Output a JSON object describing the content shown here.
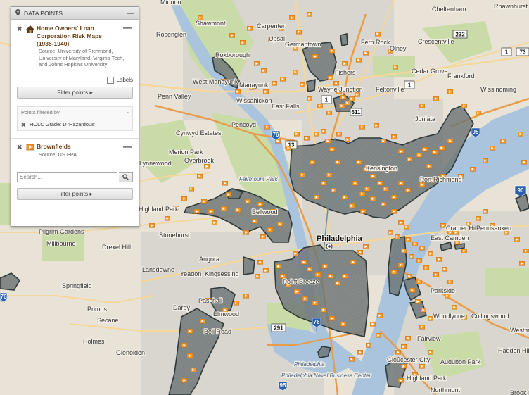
{
  "panel": {
    "title": "DATA POINTS",
    "collapse_symbol": "—",
    "layers": [
      {
        "title": "Home Owners' Loan Corporation Risk Maps (1935-1940)",
        "source": "Source: University of Richmond, University of Maryland, Virginia Tech, and Johns Hopkins University",
        "icon": "holc-house-icon"
      },
      {
        "title": "Brownfields",
        "source": "Source: US EPA",
        "icon": "brownfield-flag-icon"
      }
    ],
    "labels_checkbox": "Labels",
    "labels_checked": false,
    "filter_button": "Filter points ▸",
    "filtered_by_label": "Points filtered by:",
    "filtered_by_dash": "-",
    "filter_value": "HOLC Grade: D 'Hazardous'",
    "search_placeholder": "Search...",
    "filter_button_2": "Filter points ▸"
  },
  "map": {
    "places": [
      "Miquon",
      "Shawmont",
      "Carpenter",
      "Upsal",
      "Germantown",
      "Cheltenham",
      "Rhawnhurst",
      "Rosenglen",
      "Roxborough",
      "Fern Rock",
      "Olney",
      "Crescentville",
      "Cedar Grove",
      "Frankford",
      "West Manayunk",
      "Manayunk",
      "Penn Valley",
      "Wissahickon",
      "East Falls",
      "Wayne Junction",
      "Fishers",
      "Feltonville",
      "Wissinoming",
      "Juniata",
      "Pencoyd",
      "Cynwyd Estates",
      "Merion Park",
      "Overbrook",
      "Lynnewood",
      "Fairmount Park",
      "Kensington",
      "Port Richmond",
      "Bellwood",
      "Highland Park",
      "Pilgrim Gardens",
      "Stonehurst",
      "Drexel Hill",
      "Millbourne",
      "Philadelphia",
      "Cramer Hill",
      "Pennsauken",
      "East Camden",
      "Lansdowne",
      "Yeadon",
      "Angora",
      "Kingsessing",
      "Point Breeze",
      "Springfield",
      "Darby",
      "Paschall",
      "Elmwood",
      "Primos",
      "Secane",
      "Bell Road",
      "Holmes",
      "Glenolden",
      "Gloucester City",
      "Parkside",
      "Woodlynne",
      "Collingswood",
      "Westmont",
      "Fairview",
      "Haddon Hill",
      "Audubon Park",
      "Highland Park",
      "Northmont",
      "Philadelphia Naval Business Center",
      "Brook Haven"
    ],
    "routes": [
      "232",
      "73",
      "1",
      "1",
      "1",
      "611",
      "13",
      "76",
      "95",
      "90",
      "291",
      "76",
      "95"
    ]
  }
}
